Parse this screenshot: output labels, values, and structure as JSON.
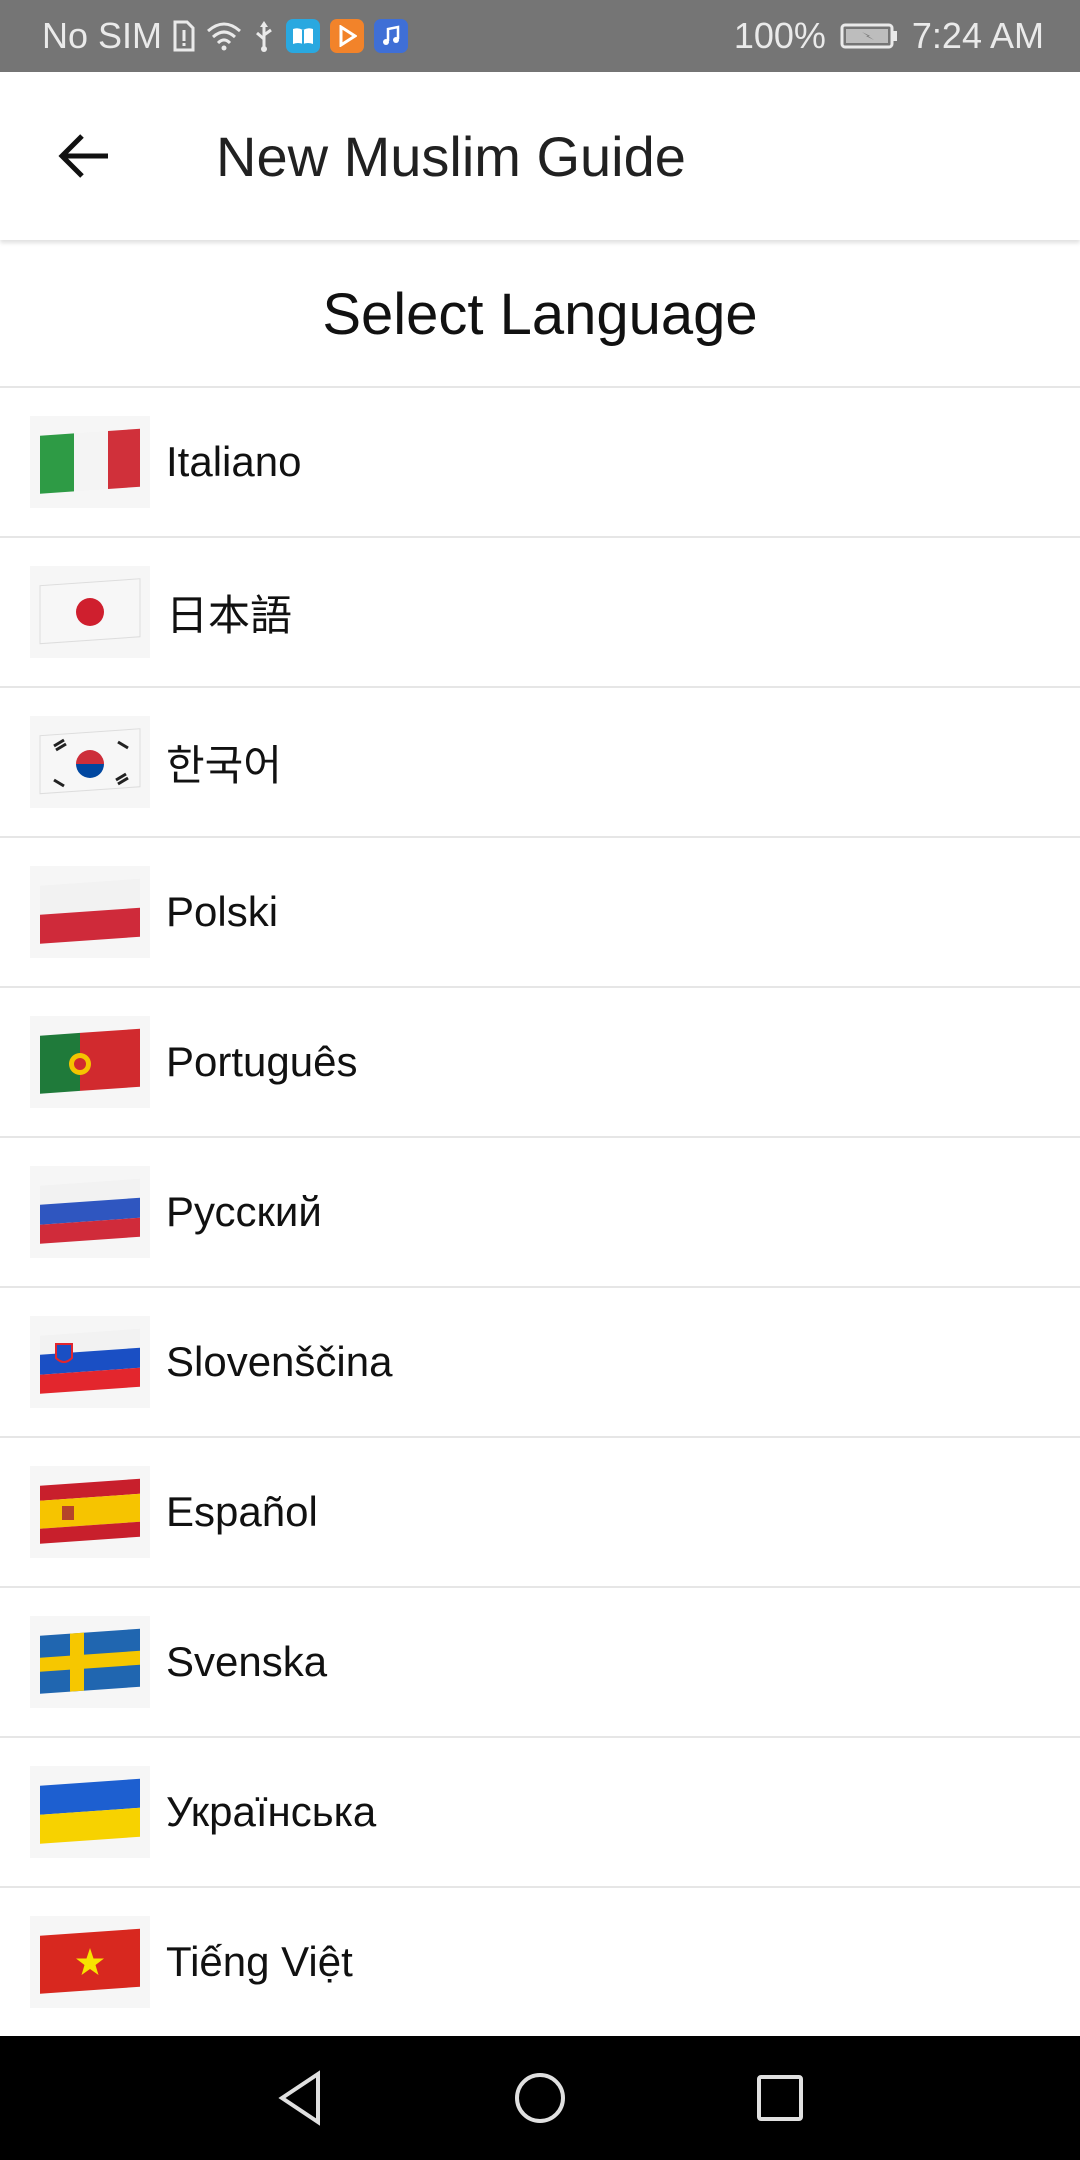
{
  "status_bar": {
    "carrier": "No SIM",
    "battery": "100%",
    "time": "7:24 AM"
  },
  "app_bar": {
    "title": "New Muslim Guide",
    "back_icon": "arrow-back-icon"
  },
  "page": {
    "heading": "Select Language"
  },
  "languages": [
    {
      "label": "Italiano",
      "flag": "italy-flag-icon"
    },
    {
      "label": "日本語",
      "flag": "japan-flag-icon"
    },
    {
      "label": "한국어",
      "flag": "korea-flag-icon"
    },
    {
      "label": "Polski",
      "flag": "poland-flag-icon"
    },
    {
      "label": "Português",
      "flag": "portugal-flag-icon"
    },
    {
      "label": "Русский",
      "flag": "russia-flag-icon"
    },
    {
      "label": "Slovenščina",
      "flag": "slovenia-flag-icon"
    },
    {
      "label": "Español",
      "flag": "spain-flag-icon"
    },
    {
      "label": "Svenska",
      "flag": "sweden-flag-icon"
    },
    {
      "label": "Українська",
      "flag": "ukraine-flag-icon"
    },
    {
      "label": "Tiếng Việt",
      "flag": "vietnam-flag-icon"
    }
  ],
  "nav_bar": {
    "back": "nav-back-icon",
    "home": "nav-home-icon",
    "recents": "nav-recents-icon"
  },
  "colors": {
    "status_bar": "#757575",
    "nav_bar": "#000000",
    "divider": "#e6e6e6"
  }
}
